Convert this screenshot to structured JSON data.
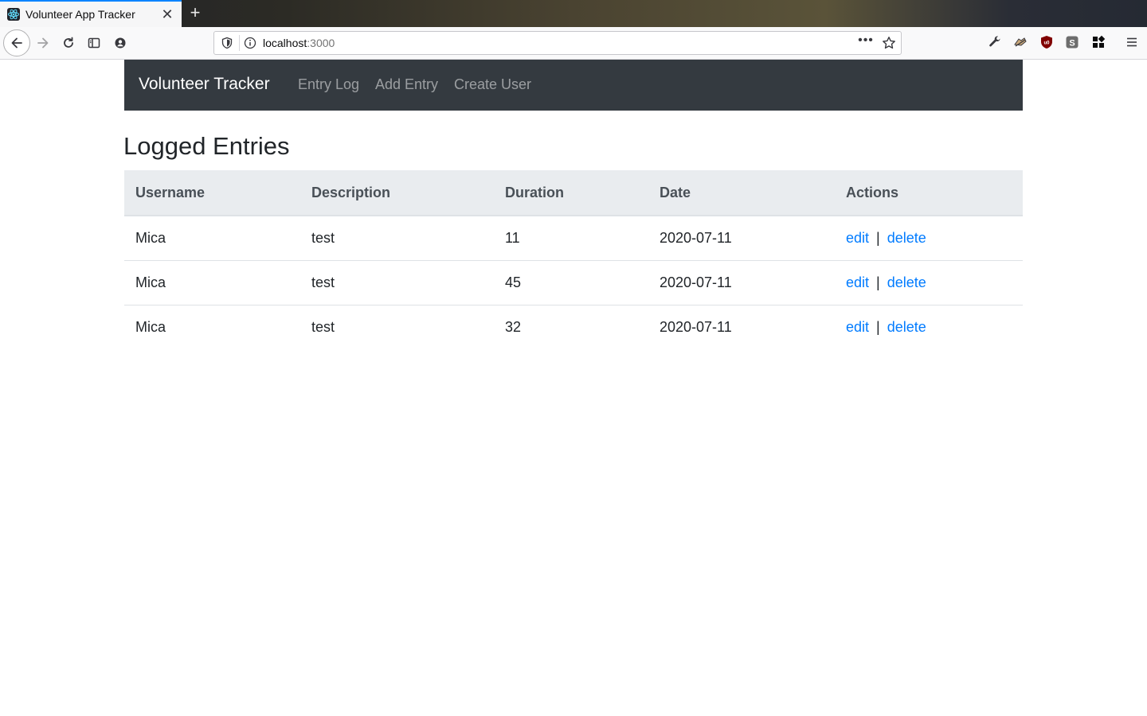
{
  "browser": {
    "tab_title": "Volunteer App Tracker",
    "tab_close": "✕",
    "new_tab": "+",
    "url_host": "localhost",
    "url_port": ":3000",
    "url_more": "•••"
  },
  "app": {
    "brand": "Volunteer Tracker",
    "nav_links": [
      "Entry Log",
      "Add Entry",
      "Create User"
    ],
    "page_title": "Logged Entries",
    "table": {
      "headers": [
        "Username",
        "Description",
        "Duration",
        "Date",
        "Actions"
      ],
      "rows": [
        {
          "username": "Mica",
          "description": "test",
          "duration": "11",
          "date": "2020-07-11"
        },
        {
          "username": "Mica",
          "description": "test",
          "duration": "45",
          "date": "2020-07-11"
        },
        {
          "username": "Mica",
          "description": "test",
          "duration": "32",
          "date": "2020-07-11"
        }
      ],
      "action_edit": "edit",
      "action_separator": "|",
      "action_delete": "delete"
    }
  },
  "colors": {
    "navbar_bg": "#343a40",
    "link": "#007bff",
    "header_bg": "#e9ecef",
    "tab_accent": "#0a84ff"
  }
}
